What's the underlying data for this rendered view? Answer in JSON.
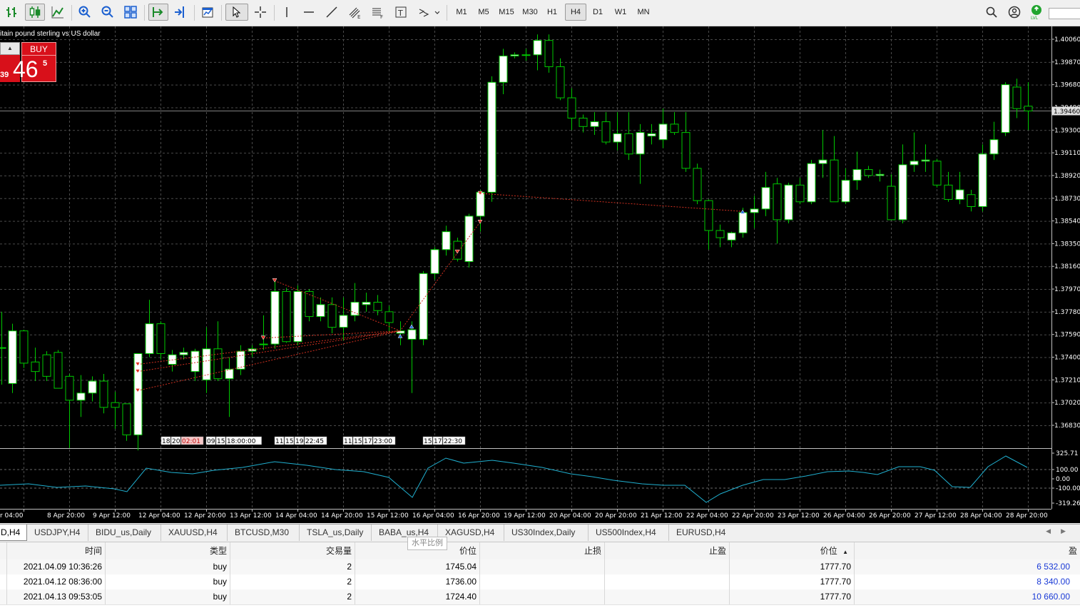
{
  "toolbar": {
    "timeframes": [
      "M1",
      "M5",
      "M15",
      "M30",
      "H1",
      "H4",
      "D1",
      "W1",
      "MN"
    ],
    "active_timeframe": "H4"
  },
  "chart": {
    "symbol_title": "itain pound sterling  vs US dollar",
    "trade_panel": {
      "buy_label": "BUY",
      "bid_prefix": "39",
      "bid_big": "46",
      "bid_sup": "5"
    },
    "current_price": "1.39460",
    "price_ticks": [
      "1.40060",
      "1.39870",
      "1.39680",
      "1.39490",
      "1.39300",
      "1.39110",
      "1.38920",
      "1.38730",
      "1.38540",
      "1.38350",
      "1.38160",
      "1.37970",
      "1.37780",
      "1.37590",
      "1.37400",
      "1.37210",
      "1.37020",
      "1.36830"
    ],
    "indicator_ticks": [
      "325.71",
      "100.00",
      "0.00",
      "-100.00",
      "-319.26"
    ],
    "time_labels": [
      "r 04:00",
      "8 Apr 20:00",
      "9 Apr 12:00",
      "12 Apr 04:00",
      "12 Apr 20:00",
      "13 Apr 12:00",
      "14 Apr 04:00",
      "14 Apr 20:00",
      "15 Apr 12:00",
      "16 Apr 04:00",
      "16 Apr 20:00",
      "19 Apr 12:00",
      "20 Apr 04:00",
      "20 Apr 20:00",
      "21 Apr 12:00",
      "22 Apr 04:00",
      "22 Apr 20:00",
      "23 Apr 12:00",
      "26 Apr 04:00",
      "26 Apr 20:00",
      "27 Apr 12:00",
      "28 Apr 04:00",
      "28 Apr 20:00"
    ],
    "trade_time_tags": [
      [
        "18:",
        "20:",
        "02:01"
      ],
      [
        "09:",
        "15:",
        "18:00:00"
      ],
      [
        "11:",
        "15:",
        "19:",
        "22:45"
      ],
      [
        "11:",
        "15:",
        "17:",
        "23:00"
      ],
      [
        "15:",
        "17:",
        "22:30"
      ]
    ],
    "colors": {
      "background": "#000000",
      "grid": "#4a4a4a",
      "bull_candle": "#ffffff",
      "wick": "#00c800",
      "indicator": "#20b0d0",
      "trade_line": "#d03020"
    }
  },
  "tabs": {
    "items": [
      "D,H4",
      "USDJPY,H4",
      "BIDU_us,Daily",
      "XAUUSD,H4",
      "BTCUSD,M30",
      "TSLA_us,Daily",
      "BABA_us,H4",
      "XAGUSD,H4",
      "US30Index,Daily",
      "US500Index,H4",
      "EURUSD,H4"
    ],
    "active_index": 0
  },
  "tooltip": "水平比例",
  "orders": {
    "headers": [
      "时间",
      "类型",
      "交易量",
      "价位",
      "止损",
      "止盈",
      "价位",
      "盈"
    ],
    "rows": [
      {
        "time": "2021.04.09 10:36:26",
        "type": "buy",
        "volume": "2",
        "open_price": "1745.04",
        "sl": "",
        "tp": "",
        "price": "1777.70",
        "profit": "6 532.00"
      },
      {
        "time": "2021.04.12 08:36:00",
        "type": "buy",
        "volume": "2",
        "open_price": "1736.00",
        "sl": "",
        "tp": "",
        "price": "1777.70",
        "profit": "8 340.00"
      },
      {
        "time": "2021.04.13 09:53:05",
        "type": "buy",
        "volume": "2",
        "open_price": "1724.40",
        "sl": "",
        "tp": "",
        "price": "1777.70",
        "profit": "10 660.00"
      }
    ]
  }
}
